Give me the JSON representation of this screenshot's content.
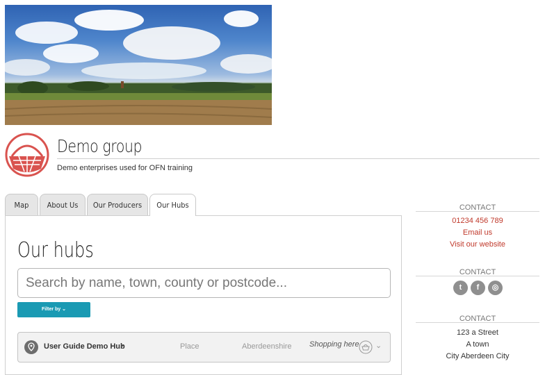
{
  "group": {
    "name": "Demo group",
    "description": "Demo enterprises used for OFN training"
  },
  "tabs": [
    {
      "label": "Map"
    },
    {
      "label": "About Us"
    },
    {
      "label": "Our Producers"
    },
    {
      "label": "Our Hubs",
      "active": true
    }
  ],
  "main": {
    "title": "Our hubs",
    "search_placeholder": "Search by name, town, county or postcode...",
    "filter_label": "Filter by",
    "hubs": [
      {
        "name": "User Guide Demo Hub",
        "arrow": "▸",
        "place": "Place",
        "county": "Aberdeenshire",
        "status": "Shopping here"
      }
    ]
  },
  "sidebar": {
    "contact_heading_1": "CONTACT",
    "phone": "01234 456 789",
    "email_link": "Email us",
    "website_link": "Visit our website",
    "contact_heading_2": "CONTACT",
    "social": [
      "twitter-icon",
      "facebook-icon",
      "instagram-icon"
    ],
    "contact_heading_3": "CONTACT",
    "address": [
      "123 a Street",
      "A town",
      "City Aberdeen City"
    ]
  },
  "colors": {
    "accent_red": "#c0392b",
    "filter_button": "#1a9ab3",
    "logo_red": "#d9534f"
  }
}
